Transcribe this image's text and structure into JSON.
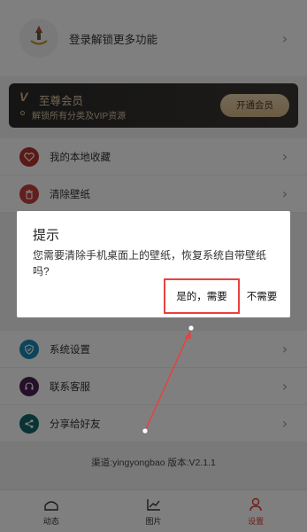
{
  "header": {
    "login_text": "登录解锁更多功能"
  },
  "vip": {
    "title": "至尊会员",
    "subtitle": "解锁所有分类及VIP资源",
    "button": "开通会员",
    "icon": "vip-v-icon"
  },
  "menu_top": [
    {
      "label": "我的本地收藏",
      "icon": "heart-icon",
      "color": "#b4342f"
    },
    {
      "label": "清除壁纸",
      "icon": "trash-icon",
      "color": "#c2413b"
    }
  ],
  "menu_bottom": [
    {
      "label": "系统设置",
      "icon": "shield-check-icon",
      "color": "#1d89b6"
    },
    {
      "label": "联系客服",
      "icon": "headset-icon",
      "color": "#4a1f55"
    },
    {
      "label": "分享给好友",
      "icon": "share-icon",
      "color": "#12666a"
    }
  ],
  "version": "渠道:yingyongbao  版本:V2.1.1",
  "nav": [
    {
      "label": "动态",
      "icon": "dynamic-icon"
    },
    {
      "label": "图片",
      "icon": "chart-icon"
    },
    {
      "label": "设置",
      "icon": "user-icon",
      "active": true
    }
  ],
  "dialog": {
    "title": "提示",
    "message": "您需要清除手机桌面上的壁纸，恢复系统自带壁纸吗?",
    "ok": "是的，需要",
    "cancel": "不需要"
  },
  "colors": {
    "accent": "#e03e3e",
    "annotation": "#e8413f"
  }
}
